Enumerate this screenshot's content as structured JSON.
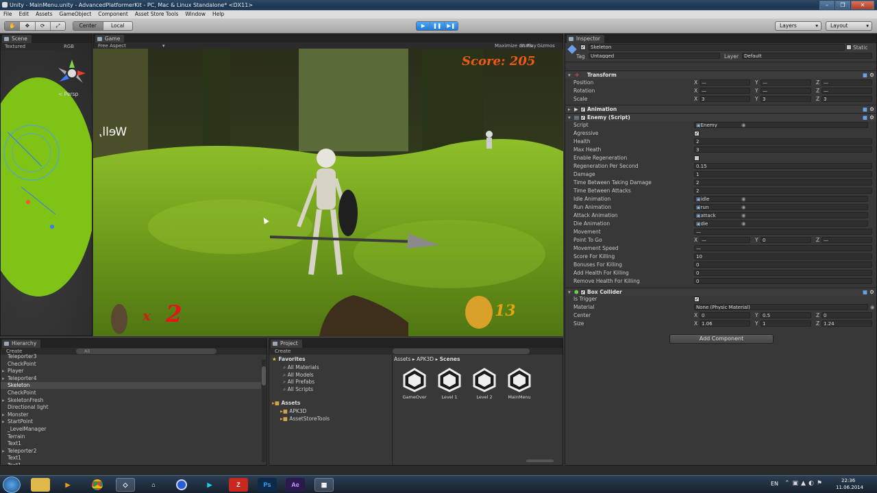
{
  "window": {
    "title": "Unity - MainMenu.unity - AdvancedPlatformerKit - PC, Mac & Linux Standalone* <DX11>"
  },
  "menu": [
    "File",
    "Edit",
    "Assets",
    "GameObject",
    "Component",
    "Asset Store Tools",
    "Window",
    "Help"
  ],
  "toolbar": {
    "pivot": "Center",
    "space": "Local",
    "layers": "Layers",
    "layout": "Layout"
  },
  "scene": {
    "tab": "Scene",
    "shading": "Textured",
    "rgb": "RGB",
    "persp": "< Persp"
  },
  "game": {
    "tab": "Game",
    "aspect": "Free Aspect",
    "buttons": [
      "Maximize on Play",
      "Stats",
      "Gizmos"
    ],
    "hud": {
      "score": "Score: 205",
      "lives_x": "x",
      "lives": "2",
      "gold": "13",
      "speech": "Well,"
    }
  },
  "inspector": {
    "tab": "Inspector",
    "object": {
      "name": "Skeleton",
      "static": "Static",
      "tag_label": "Tag",
      "tag": "Untagged",
      "layer_label": "Layer",
      "layer": "Default"
    },
    "transform": {
      "title": "Transform",
      "rows": [
        {
          "label": "Position",
          "x": "—",
          "y": "—",
          "z": "—"
        },
        {
          "label": "Rotation",
          "x": "—",
          "y": "—",
          "z": "—"
        },
        {
          "label": "Scale",
          "x": "3",
          "y": "3",
          "z": "3"
        }
      ]
    },
    "animation": {
      "title": "Animation"
    },
    "enemy": {
      "title": "Enemy (Script)",
      "rows": [
        {
          "label": "Script",
          "value": "Enemy",
          "kind": "obj"
        },
        {
          "label": "Agressive",
          "value": "✓",
          "kind": "check"
        },
        {
          "label": "Health",
          "value": "2",
          "kind": "field"
        },
        {
          "label": "Max Heath",
          "value": "3",
          "kind": "field"
        },
        {
          "label": "Enable Regeneration",
          "value": "",
          "kind": "check"
        },
        {
          "label": "Regeneration Per Second",
          "value": "0.15",
          "kind": "field"
        },
        {
          "label": "Damage",
          "value": "1",
          "kind": "field"
        },
        {
          "label": "Time Between Taking Damage",
          "value": "2",
          "kind": "field"
        },
        {
          "label": "Time Between Attacks",
          "value": "2",
          "kind": "field"
        },
        {
          "label": "Idle Animation",
          "value": "idle",
          "kind": "obj"
        },
        {
          "label": "Run Animation",
          "value": "run",
          "kind": "obj"
        },
        {
          "label": "Attack Animation",
          "value": "attack",
          "kind": "obj"
        },
        {
          "label": "Die Animation",
          "value": "die",
          "kind": "obj"
        },
        {
          "label": "Movement",
          "value": "—",
          "kind": "enum"
        },
        {
          "label": "Point To Go",
          "value": "",
          "kind": "xyz",
          "x": "—",
          "y": "0",
          "z": "—"
        },
        {
          "label": "Movement Speed",
          "value": "—",
          "kind": "field"
        },
        {
          "label": "Score For Killing",
          "value": "10",
          "kind": "field"
        },
        {
          "label": "Bonuses For Killing",
          "value": "0",
          "kind": "field"
        },
        {
          "label": "Add Health For Killing",
          "value": "0",
          "kind": "field"
        },
        {
          "label": "Remove Health For Killing",
          "value": "0",
          "kind": "field"
        }
      ]
    },
    "box_collider": {
      "title": "Box Collider",
      "is_trigger": "Is Trigger",
      "material_label": "Material",
      "material": "None (Physic Material)",
      "center": {
        "label": "Center",
        "x": "0",
        "y": "0.5",
        "z": "0"
      },
      "size": {
        "label": "Size",
        "x": "1.06",
        "y": "1",
        "z": "1.24"
      }
    },
    "add_component": "Add Component"
  },
  "hierarchy": {
    "tab": "Hierarchy",
    "create": "Create",
    "search": "All",
    "items": [
      "Teleporter3",
      "CheckPoint",
      "Player",
      "Teleporter4",
      "Skeleton",
      "CheckPoint",
      "SkeletonFresh",
      "Directional light",
      "Monster",
      "StartPoint",
      "_LevelManager",
      "Terrain",
      "Text1",
      "Teleporter2",
      "Text1",
      "Text1"
    ],
    "selected_index": 4,
    "expandable": [
      2,
      3,
      4,
      6,
      8,
      9,
      13
    ]
  },
  "project": {
    "tab": "Project",
    "create": "Create",
    "favorites": {
      "label": "Favorites",
      "items": [
        "All Materials",
        "All Models",
        "All Prefabs",
        "All Scripts"
      ]
    },
    "assets": {
      "label": "Assets",
      "items": [
        "APK3D",
        "AssetStoreTools"
      ]
    },
    "breadcrumb": [
      "Assets",
      "APK3D",
      "Scenes"
    ],
    "scenes": [
      "GameOver",
      "Level 1",
      "Level 2",
      "MainMenu"
    ]
  },
  "taskbar": {
    "apps": [
      "explorer",
      "media",
      "chrome",
      "unity",
      "launcher",
      "browser",
      "sdk",
      "filezilla",
      "Ps",
      "Ae",
      "film"
    ],
    "lang": "EN",
    "time": "22:36",
    "date": "11.06.2014"
  }
}
